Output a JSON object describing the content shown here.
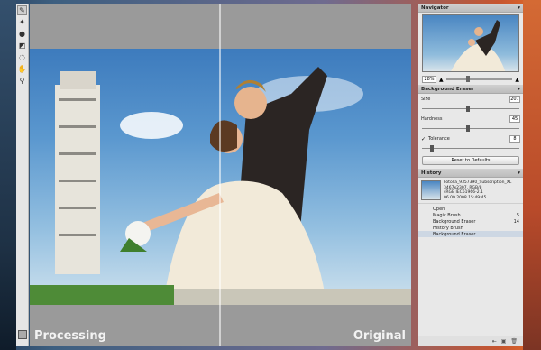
{
  "canvas": {
    "left_label": "Processing",
    "right_label": "Original"
  },
  "navigator": {
    "title": "Navigator",
    "zoom": "28%"
  },
  "background_eraser": {
    "title": "Background Eraser",
    "size_label": "Size",
    "size_value": "207",
    "hardness_label": "Hardness",
    "hardness_value": "45",
    "tolerance_label": "Tolerance",
    "tolerance_value": "8",
    "reset_label": "Reset to Defaults"
  },
  "history": {
    "title": "History",
    "file_name": "Fotolia_9357390_Subscription_XL",
    "file_dims": "3467x2307, RGB/8",
    "file_profile": "sRGB IEC61966-2.1",
    "file_date": "06.09.2008 15:49:45",
    "items": [
      {
        "label": "Open",
        "count": ""
      },
      {
        "label": "Magic Brush",
        "count": "5"
      },
      {
        "label": "Background Eraser",
        "count": "14"
      },
      {
        "label": "History Brush",
        "count": ""
      },
      {
        "label": "Background Eraser",
        "count": ""
      }
    ]
  },
  "icons": {
    "tools": [
      "brush-icon",
      "wand-icon",
      "drop-icon",
      "eraser-icon",
      "lasso-icon",
      "hand-icon",
      "zoom-icon"
    ],
    "footer": [
      "arrow-icon",
      "new-snapshot-icon",
      "delete-icon"
    ]
  }
}
